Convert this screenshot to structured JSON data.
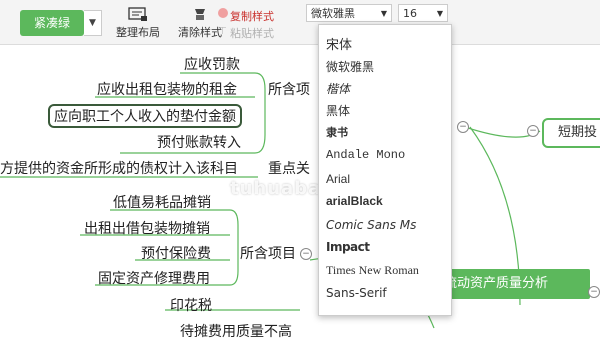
{
  "toolbar": {
    "theme_button": "紧凑绿",
    "tidy_layout": "整理布局",
    "clear_style": "清除样式",
    "copy_style": "复制样式",
    "paste_style": "粘贴样式",
    "font_family": "微软雅黑",
    "font_size": "16"
  },
  "font_dropdown": {
    "options": [
      "宋体",
      "微软雅黑",
      "楷体",
      "黑体",
      "隶书",
      "Andale Mono",
      "Arial",
      "arialBlack",
      "Comic Sans Ms",
      "Impact",
      "Times New Roman",
      "Sans-Serif"
    ]
  },
  "mindmap": {
    "nodes": {
      "n1": "应收罚款",
      "n2": "应收出租包装物的租金",
      "n3": "应向职工个人收入的垫付金额",
      "n4": "预付账款转入",
      "n5": "方提供的资金所形成的债权计入该科目",
      "n6": "低值易耗品摊销",
      "n7": "出租出借包装物摊销",
      "n8": "预付保险费",
      "n9": "固定资产修理费用",
      "n10": "印花税",
      "n11": "待摊费用质量不高",
      "group1": "所含项",
      "group2": "重点关",
      "group3": "所含项目",
      "right_box": "短期投",
      "green_node": "流动资产质量分析"
    }
  },
  "watermark": "tuhuaba.com",
  "colors": {
    "accent_green": "#5cb85c",
    "copy_red": "#c9302c"
  }
}
